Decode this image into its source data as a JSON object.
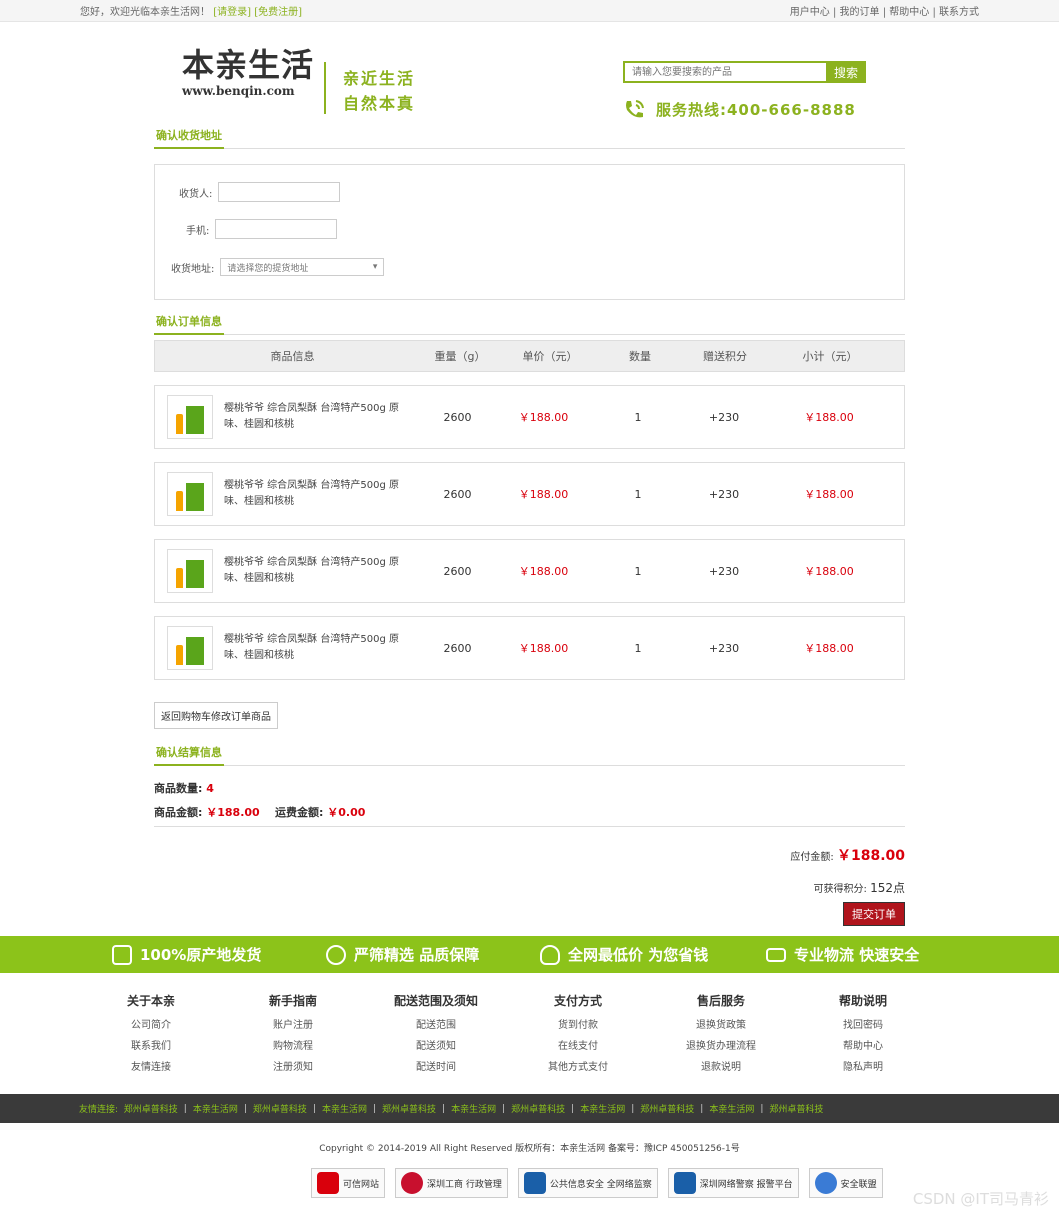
{
  "topbar": {
    "welcome": "您好，欢迎光临本亲生活网！",
    "login": "[请登录]",
    "register": "[免费注册]",
    "links": [
      "用户中心",
      "我的订单",
      "帮助中心",
      "联系方式"
    ]
  },
  "header": {
    "logo_cn": "本亲生活",
    "logo_url": "www.benqin.com",
    "slogan1": "亲近生活",
    "slogan2": "自然本真",
    "search_placeholder": "请输入您要搜索的产品",
    "search_button": "搜索",
    "hotline": "服务热线:400-666-8888"
  },
  "address": {
    "title": "确认收货地址",
    "receiver_label": "收货人:",
    "phone_label": "手机:",
    "addr_label": "收货地址:",
    "addr_placeholder": "请选择您的提货地址"
  },
  "order": {
    "title": "确认订单信息",
    "headers": [
      "商品信息",
      "重量（g）",
      "单价（元）",
      "数量",
      "赠送积分",
      "小计（元）"
    ],
    "rows": [
      {
        "name": "樱桃爷爷 综合凤梨酥 台湾特产500g 原味、桂圆和核桃",
        "weight": "2600",
        "price": "￥188.00",
        "qty": "1",
        "points": "+230",
        "subtotal": "￥188.00"
      },
      {
        "name": "樱桃爷爷 综合凤梨酥 台湾特产500g 原味、桂圆和核桃",
        "weight": "2600",
        "price": "￥188.00",
        "qty": "1",
        "points": "+230",
        "subtotal": "￥188.00"
      },
      {
        "name": "樱桃爷爷 综合凤梨酥 台湾特产500g 原味、桂圆和核桃",
        "weight": "2600",
        "price": "￥188.00",
        "qty": "1",
        "points": "+230",
        "subtotal": "￥188.00"
      },
      {
        "name": "樱桃爷爷 综合凤梨酥 台湾特产500g 原味、桂圆和核桃",
        "weight": "2600",
        "price": "￥188.00",
        "qty": "1",
        "points": "+230",
        "subtotal": "￥188.00"
      }
    ],
    "back_button": "返回购物车修改订单商品"
  },
  "settle": {
    "title": "确认结算信息",
    "count_label": "商品数量:",
    "count": "4",
    "amount_label": "商品金额:",
    "amount": "￥188.00",
    "shipping_label": "运费金额:",
    "shipping": "￥0.00",
    "payable_label": "应付金额:",
    "payable": "￥188.00",
    "points_label": "可获得积分:",
    "points": "152点",
    "submit": "提交订单"
  },
  "band": [
    "100%原产地发货",
    "严筛精选  品质保障",
    "全网最低价 为您省钱",
    "专业物流  快速安全"
  ],
  "help": [
    {
      "h": "关于本亲",
      "items": [
        "公司简介",
        "联系我们",
        "友情连接"
      ]
    },
    {
      "h": "新手指南",
      "items": [
        "账户注册",
        "购物流程",
        "注册须知"
      ]
    },
    {
      "h": "配送范围及须知",
      "items": [
        "配送范围",
        "配送须知",
        "配送时间"
      ]
    },
    {
      "h": "支付方式",
      "items": [
        "货到付款",
        "在线支付",
        "其他方式支付"
      ]
    },
    {
      "h": "售后服务",
      "items": [
        "退换货政策",
        "退换货办理流程",
        "退款说明"
      ]
    },
    {
      "h": "帮助说明",
      "items": [
        "找回密码",
        "帮助中心",
        "隐私声明"
      ]
    }
  ],
  "friend_links": {
    "label": "友情连接:",
    "items": [
      "郑州卓普科技",
      "本亲生活网",
      "郑州卓普科技",
      "本亲生活网",
      "郑州卓普科技",
      "本亲生活网",
      "郑州卓普科技",
      "本亲生活网",
      "郑州卓普科技",
      "本亲生活网",
      "郑州卓普科技"
    ]
  },
  "copyright": "Copyright © 2014-2019 All Right Reserved 版权所有：本亲生活网 备案号：豫ICP 450051256-1号",
  "badges": [
    {
      "label": "可信网站",
      "color": "#d9000c"
    },
    {
      "label": "深圳工商 行政管理",
      "color": "#c8102e"
    },
    {
      "label": "公共信息安全 全网络监察",
      "color": "#1a5fa8"
    },
    {
      "label": "深圳网络警察 报警平台",
      "color": "#1a5fa8"
    },
    {
      "label": "安全联盟",
      "color": "#3a7bd5"
    }
  ],
  "watermark": "CSDN @IT司马青衫"
}
